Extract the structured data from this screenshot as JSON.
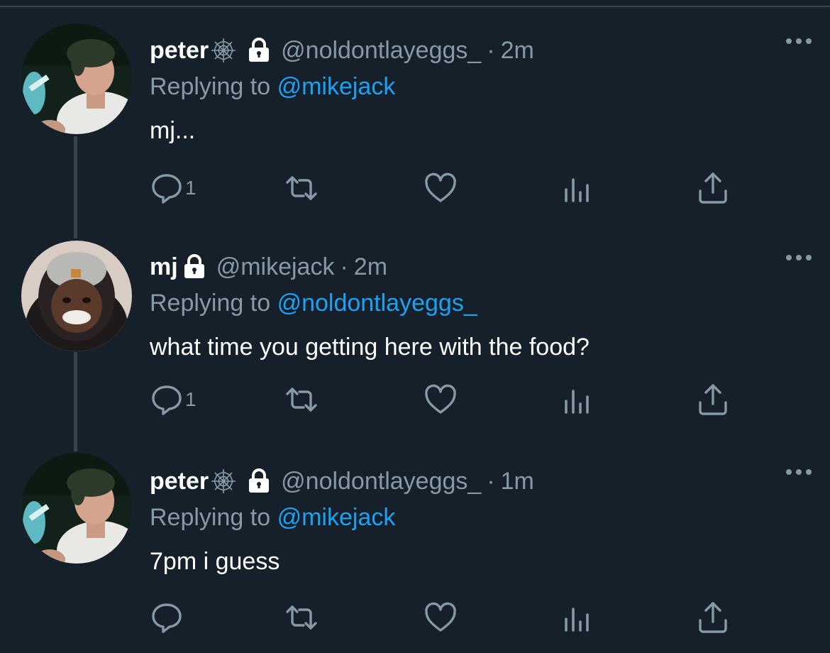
{
  "tweets": [
    {
      "name": "peter",
      "handle": "@noldontlayeggs_",
      "separator": "·",
      "time": "2m",
      "replying_prefix": "Replying to",
      "replying_to": "@mikejack",
      "text": "mj...",
      "reply_count": "1",
      "icons": [
        "spiderweb-icon",
        "lock-icon"
      ]
    },
    {
      "name": "mj",
      "handle": "@mikejack",
      "separator": "·",
      "time": "2m",
      "replying_prefix": "Replying to",
      "replying_to": "@noldontlayeggs_",
      "text": "what time you getting here with the food?",
      "reply_count": "1",
      "icons": [
        "lock-icon"
      ]
    },
    {
      "name": "peter",
      "handle": "@noldontlayeggs_",
      "separator": "·",
      "time": "1m",
      "replying_prefix": "Replying to",
      "replying_to": "@mikejack",
      "text": "7pm i guess",
      "reply_count": "",
      "icons": [
        "spiderweb-icon",
        "lock-icon"
      ]
    }
  ],
  "colors": {
    "background": "#15202b",
    "primary_text": "#ffffff",
    "secondary_text": "#8899a6",
    "accent": "#1da1f2",
    "thread_line": "#38444d"
  },
  "action_icons": [
    "reply-icon",
    "retweet-icon",
    "like-icon",
    "analytics-icon",
    "share-icon"
  ]
}
